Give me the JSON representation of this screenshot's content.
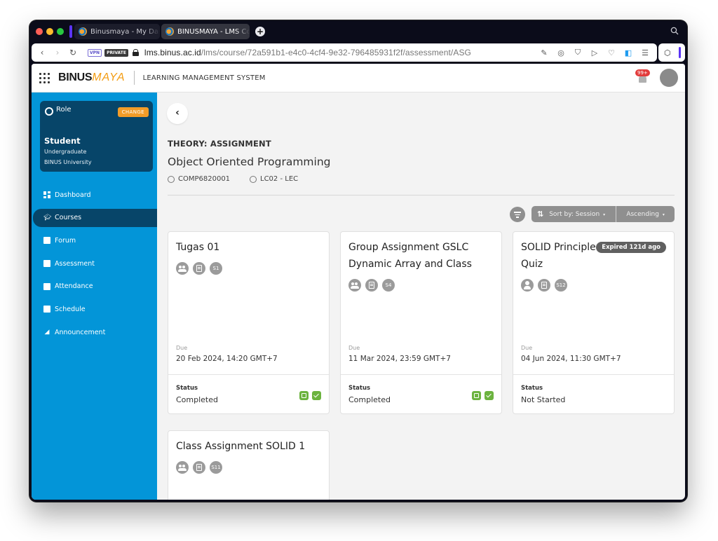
{
  "browser": {
    "tabs": [
      {
        "title": "Binusmaya - My Dashboard",
        "active": false
      },
      {
        "title": "BINUSMAYA - LMS Course",
        "active": true
      }
    ],
    "new_tab_icon": "plus-icon",
    "search_icon": "search-icon",
    "nav": {
      "back": "‹",
      "forward": "›",
      "reload": "↻"
    },
    "badges": {
      "vpn": "VPN",
      "private": "PRIVATE"
    },
    "url_host": "lms.binus.ac.id",
    "url_path": "/lms/course/72a591b1-e4c0-4cf4-9e32-796485931f2f/assessment/ASG",
    "toolbar_icons": [
      "edit-icon",
      "camera-icon",
      "shield-icon",
      "send-icon",
      "heart-icon",
      "sidebar-toggle-icon",
      "settings-sliders-icon"
    ],
    "extension_icon": "cube-icon"
  },
  "header": {
    "app_logo_primary": "BINUS",
    "app_logo_secondary": "MAYA",
    "system_title": "LEARNING MANAGEMENT SYSTEM",
    "notification_count": "99+"
  },
  "sidebar": {
    "role": {
      "label": "Role",
      "change_label": "CHANGE",
      "name": "Student",
      "level": "Undergraduate",
      "institution": "BINUS University"
    },
    "items": [
      {
        "label": "Dashboard",
        "icon": "dashboard-icon",
        "active": false
      },
      {
        "label": "Courses",
        "icon": "graduation-cap-icon",
        "active": true
      },
      {
        "label": "Forum",
        "icon": "forum-icon",
        "active": false
      },
      {
        "label": "Assessment",
        "icon": "assessment-icon",
        "active": false
      },
      {
        "label": "Attendance",
        "icon": "attendance-icon",
        "active": false
      },
      {
        "label": "Schedule",
        "icon": "calendar-icon",
        "active": false
      },
      {
        "label": "Announcement",
        "icon": "megaphone-icon",
        "active": false
      }
    ]
  },
  "main": {
    "section_title": "THEORY: ASSIGNMENT",
    "course_name": "Object Oriented Programming",
    "course_code": "COMP6820001",
    "class_code": "LC02 - LEC",
    "sort": {
      "sort_by_label": "Sort by: Session",
      "order_label": "Ascending"
    },
    "cards": [
      {
        "title": "Tugas 01",
        "type": "group",
        "session": "S1",
        "expired_badge": null,
        "due_label": "Due",
        "due": "20 Feb 2024, 14:20 GMT+7",
        "status_label": "Status",
        "status": "Completed",
        "status_icons": [
          "feedback-icon",
          "check-icon"
        ]
      },
      {
        "title": "Group Assignment GSLC Dynamic Array and Class",
        "type": "group",
        "session": "S4",
        "expired_badge": null,
        "due_label": "Due",
        "due": "11 Mar 2024, 23:59 GMT+7",
        "status_label": "Status",
        "status": "Completed",
        "status_icons": [
          "feedback-icon",
          "check-icon"
        ]
      },
      {
        "title": "SOLID Principle Quiz",
        "type": "individual",
        "session": "S12",
        "expired_badge": "Expired 121d ago",
        "due_label": "Due",
        "due": "04 Jun 2024, 11:30 GMT+7",
        "status_label": "Status",
        "status": "Not Started",
        "status_icons": []
      },
      {
        "title": "Class Assignment SOLID 1",
        "type": "group",
        "session": "S11",
        "expired_badge": null
      }
    ]
  }
}
